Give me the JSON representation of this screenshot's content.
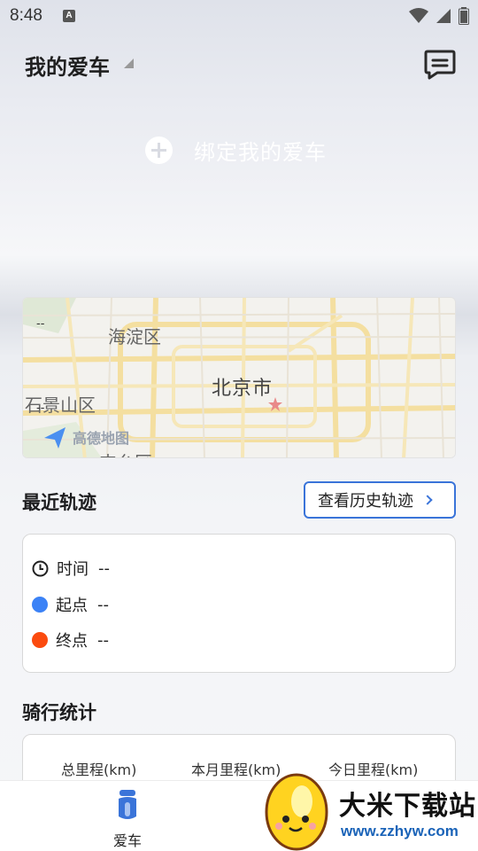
{
  "status_bar": {
    "time": "8:48",
    "badge": "A",
    "icons": [
      "wifi-icon",
      "signal-icon",
      "battery-icon"
    ]
  },
  "header": {
    "title": "我的爱车",
    "icon": "message-icon"
  },
  "bind": {
    "label": "绑定我的爱车",
    "icon": "plus-circle-icon"
  },
  "map": {
    "districts": [
      "海淀区",
      "石景山区",
      "北京市",
      "丰台区"
    ],
    "placeholders": [
      "--",
      "--"
    ],
    "logo_text": "高德地图"
  },
  "recent_track": {
    "title": "最近轨迹",
    "history_button": "查看历史轨迹",
    "rows": [
      {
        "label": "时间",
        "value": "--",
        "icon": "clock-icon"
      },
      {
        "label": "起点",
        "value": "--",
        "color": "#3b82f6"
      },
      {
        "label": "终点",
        "value": "--",
        "color": "#fb4b0f"
      }
    ]
  },
  "ride_stats": {
    "title": "骑行统计",
    "labels": [
      "总里程(km)",
      "本月里程(km)",
      "今日里程(km)"
    ]
  },
  "bottom_nav": {
    "items": [
      {
        "label": "爱车",
        "icon": "scooter-icon",
        "active": true
      }
    ]
  },
  "watermark": {
    "title": "大米下载站",
    "url": "www.zzhyw.com"
  },
  "colors": {
    "accent": "#3a74d9",
    "start_dot": "#3b82f6",
    "end_dot": "#fb4b0f"
  }
}
